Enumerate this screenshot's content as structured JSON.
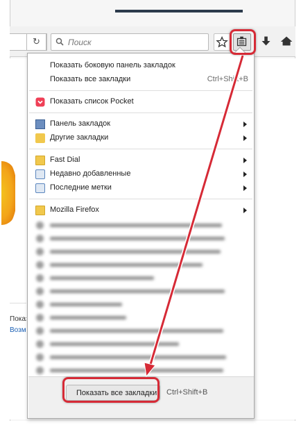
{
  "toolbar": {
    "search_placeholder": "Поиск"
  },
  "menu": {
    "top_items": [
      {
        "label": "Показать боковую панель закладок",
        "shortcut": ""
      },
      {
        "label": "Показать все закладки",
        "shortcut": "Ctrl+Shift+B"
      }
    ],
    "pocket": {
      "label": "Показать список Pocket",
      "icon": "pocket-icon"
    },
    "folders_a": [
      {
        "label": "Панель закладок",
        "icon": "bookmarks-toolbar-icon",
        "submenu": true
      },
      {
        "label": "Другие закладки",
        "icon": "other-bookmarks-icon",
        "submenu": true
      }
    ],
    "folders_b": [
      {
        "label": "Fast Dial",
        "icon": "folder-icon",
        "submenu": true
      },
      {
        "label": "Недавно добавленные",
        "icon": "smart-query-icon",
        "submenu": true
      },
      {
        "label": "Последние метки",
        "icon": "smart-query-icon",
        "submenu": true
      }
    ],
    "firefox_folder": {
      "label": "Mozilla Firefox",
      "icon": "folder-icon",
      "submenu": true
    },
    "bottom": {
      "label": "Показать все закладки",
      "shortcut": "Ctrl+Shift+B"
    }
  },
  "page": {
    "side_text_1": "Показать в",
    "side_text_2": "Возмож"
  },
  "colors": {
    "highlight": "#d62a36",
    "folder": "#f1c84d",
    "pocket": "#ef3f56"
  }
}
